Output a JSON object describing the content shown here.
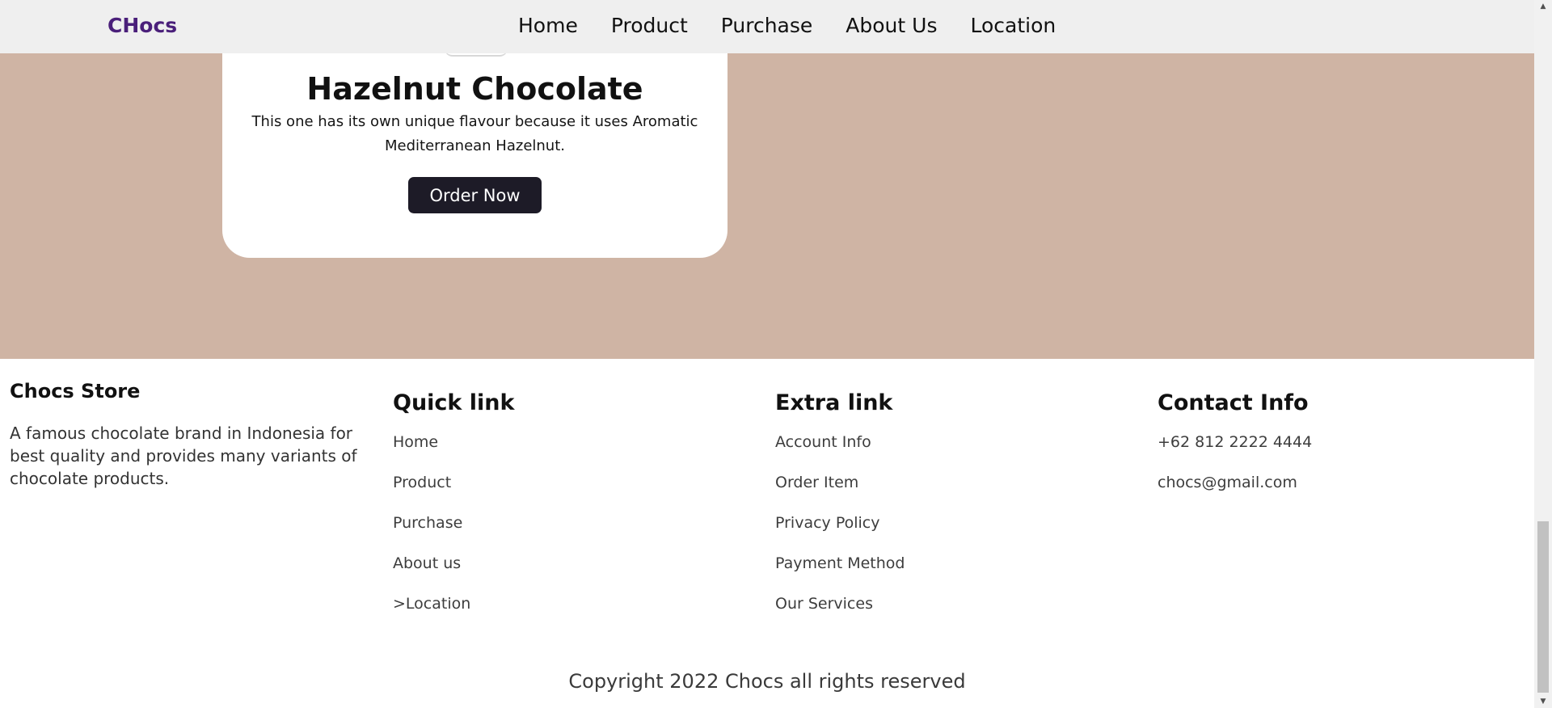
{
  "navbar": {
    "brand": "CHocs",
    "links": [
      "Home",
      "Product",
      "Purchase",
      "About Us",
      "Location"
    ]
  },
  "product_card": {
    "title": "Hazelnut Chocolate",
    "description": "This one has its own unique flavour because it uses Aromatic Mediterranean Hazelnut.",
    "button_label": "Order Now"
  },
  "footer": {
    "about": {
      "title": "Chocs Store",
      "description": "A famous chocolate brand in Indonesia for best quality and provides many variants of chocolate products."
    },
    "quick_link": {
      "title": "Quick link",
      "items": [
        "Home",
        "Product",
        "Purchase",
        "About us",
        ">Location"
      ]
    },
    "extra_link": {
      "title": "Extra link",
      "items": [
        "Account Info",
        "Order Item",
        "Privacy Policy",
        "Payment Method",
        "Our Services"
      ]
    },
    "contact": {
      "title": "Contact Info",
      "items": [
        "+62 812 2222 4444",
        "chocs@gmail.com"
      ]
    },
    "copyright": "Copyright 2022 Chocs all rights reserved"
  },
  "colors": {
    "brand": "#4a1f7a",
    "hero_background": "#cfb4a4",
    "button_background": "#1d1b27",
    "navbar_background": "#efefef"
  },
  "icons": {
    "scroll_up": "scroll-up-arrow-icon",
    "scroll_down": "scroll-down-arrow-icon"
  }
}
